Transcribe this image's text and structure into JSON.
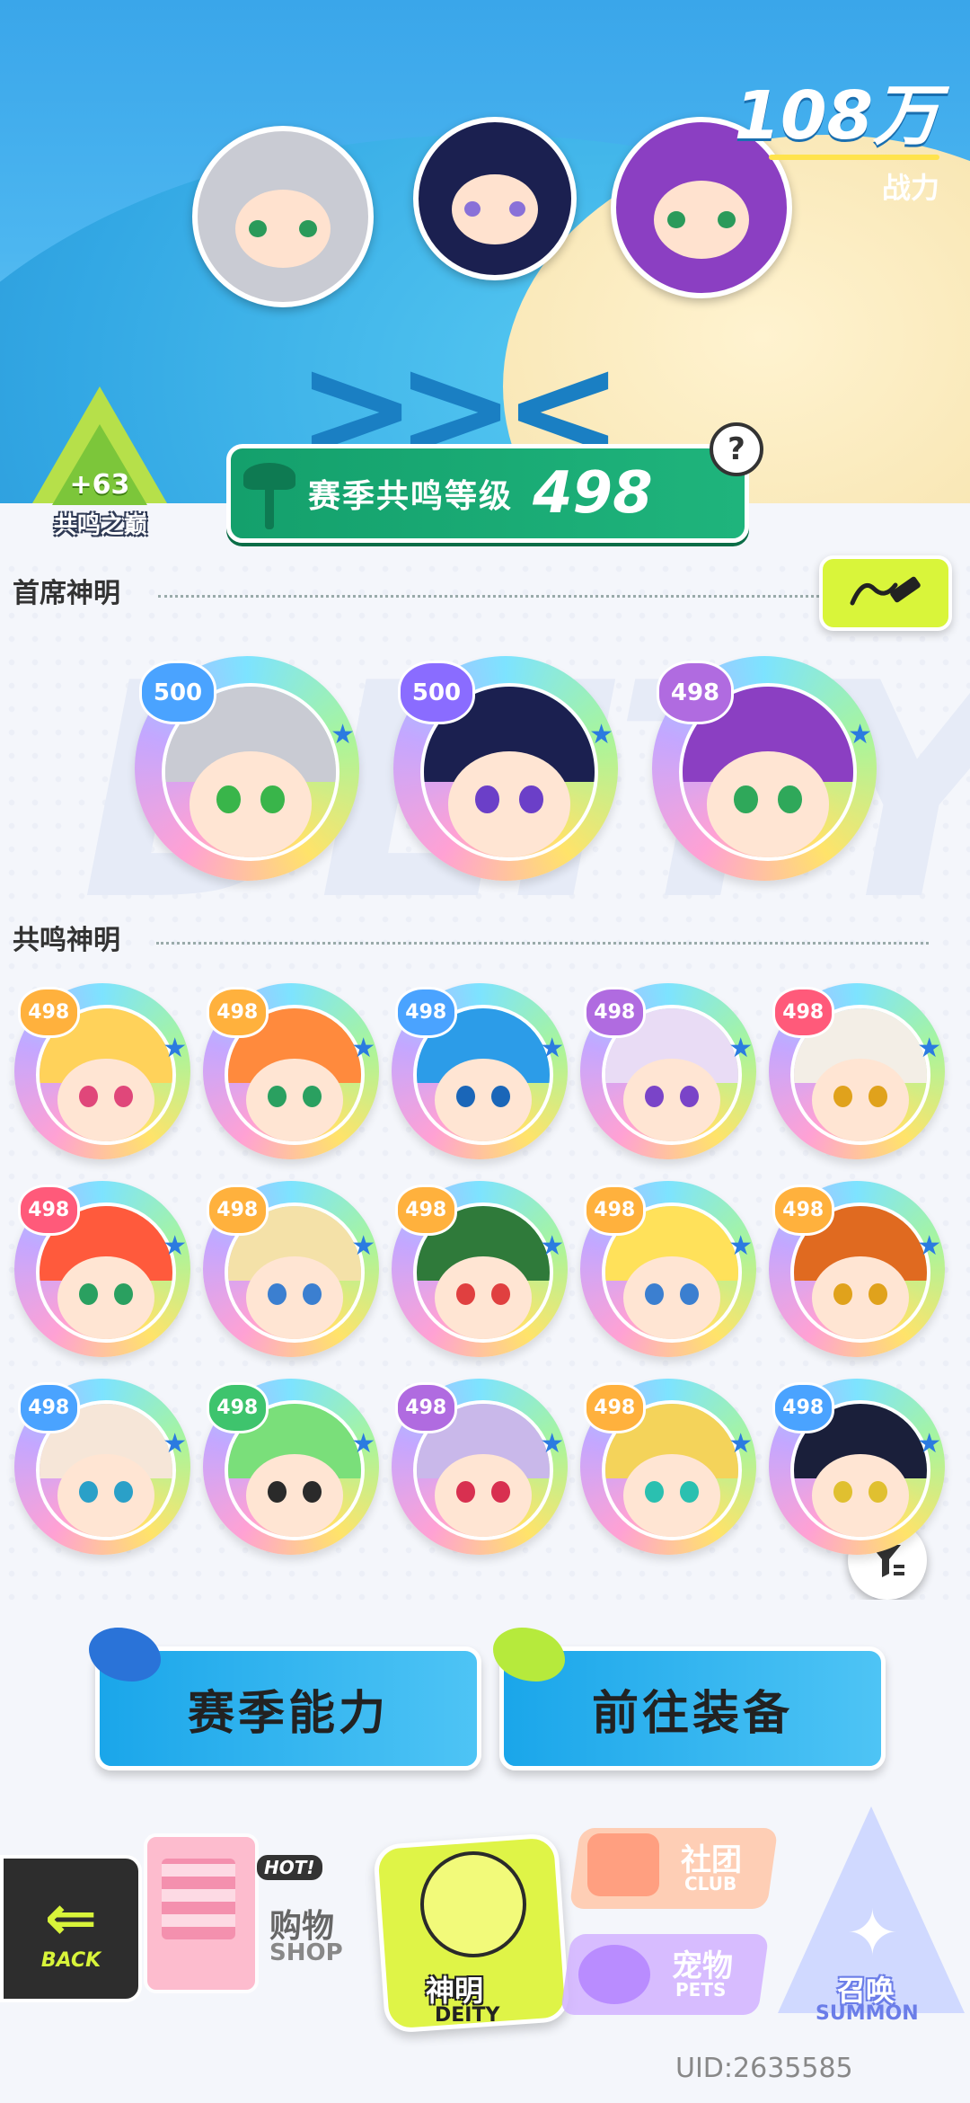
{
  "header": {
    "combat_power": "108万",
    "combat_power_label": "战力"
  },
  "resonance_peak": {
    "bonus": "+63",
    "name": "共鸣之巅"
  },
  "season_level": {
    "label": "赛季共鸣等级",
    "value": "498",
    "help": "?"
  },
  "sections": {
    "chief": "首席神明",
    "resonance": "共鸣神明"
  },
  "chief_deities": [
    {
      "level": "500",
      "hair": "#c9cbd3",
      "eyes": "#39b54a",
      "badge": "#4aa3ff"
    },
    {
      "level": "500",
      "hair": "#1b2050",
      "eyes": "#6b3fc8",
      "badge": "#8a6cff"
    },
    {
      "level": "498",
      "hair": "#8b3fc2",
      "eyes": "#2fa85a",
      "badge": "#b06be0"
    }
  ],
  "resonance_deities": [
    {
      "level": "498",
      "hair": "#ffd25a",
      "eyes": "#e0477a",
      "badge": "#ffb13d"
    },
    {
      "level": "498",
      "hair": "#ff8a3d",
      "eyes": "#2aa060",
      "badge": "#ffb13d"
    },
    {
      "level": "498",
      "hair": "#2c9ce8",
      "eyes": "#1a66b8",
      "badge": "#4aa3ff"
    },
    {
      "level": "498",
      "hair": "#e9dcf5",
      "eyes": "#7a44c8",
      "badge": "#b06be0"
    },
    {
      "level": "498",
      "hair": "#f3eee6",
      "eyes": "#e0a21c",
      "badge": "#ff5a7a"
    },
    {
      "level": "498",
      "hair": "#ff5a3c",
      "eyes": "#2aa060",
      "badge": "#ff5a7a"
    },
    {
      "level": "498",
      "hair": "#f4e1a8",
      "eyes": "#3b7fd0",
      "badge": "#ffb13d"
    },
    {
      "level": "498",
      "hair": "#2f7a3a",
      "eyes": "#e04040",
      "badge": "#ffb13d"
    },
    {
      "level": "498",
      "hair": "#ffe15a",
      "eyes": "#3b7fd0",
      "badge": "#ffb13d"
    },
    {
      "level": "498",
      "hair": "#e06a20",
      "eyes": "#e0a21c",
      "badge": "#ffb13d"
    },
    {
      "level": "498",
      "hair": "#f6e6d8",
      "eyes": "#2aa0c8",
      "badge": "#4aa3ff"
    },
    {
      "level": "498",
      "hair": "#7adf7a",
      "eyes": "#2a2a2a",
      "badge": "#3ec46d"
    },
    {
      "level": "498",
      "hair": "#c9b8ea",
      "eyes": "#d83050",
      "badge": "#b06be0"
    },
    {
      "level": "498",
      "hair": "#f4d35a",
      "eyes": "#2ac0b0",
      "badge": "#ffb13d"
    },
    {
      "level": "498",
      "hair": "#1a1f3a",
      "eyes": "#e0c030",
      "badge": "#4aa3ff"
    }
  ],
  "actions": {
    "season_ability": "赛季能力",
    "go_equipment": "前往装备"
  },
  "nav": {
    "back": "BACK",
    "shop_hot": "HOT!",
    "shop_zh": "购物",
    "shop_en": "SHOP",
    "deity_zh": "神明",
    "deity_en": "DEITY",
    "club_zh": "社团",
    "club_en": "CLUB",
    "pets_zh": "宠物",
    "pets_en": "PETS",
    "summon_zh": "召唤",
    "summon_en": "SUMMON"
  },
  "uid": "UID:2635585",
  "colors": {
    "accent_green": "#1fb47c",
    "accent_lime": "#d9f53a",
    "action_blue": "#1aa6ea"
  }
}
